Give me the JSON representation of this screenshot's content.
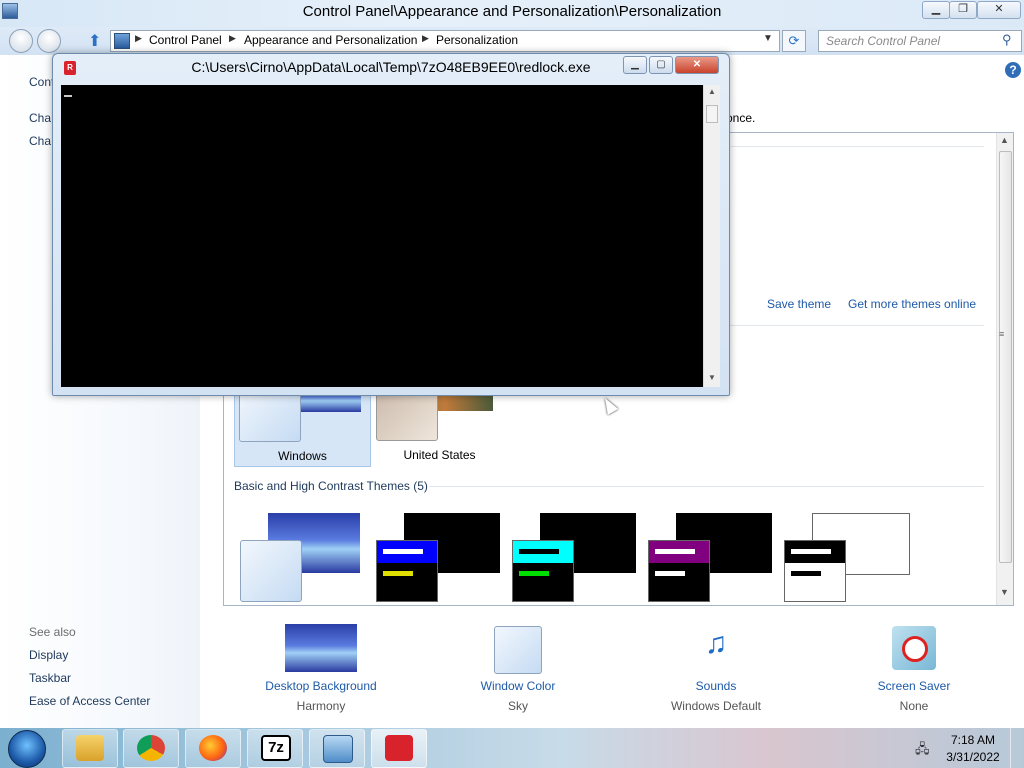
{
  "explorer": {
    "title": "Control Panel\\Appearance and Personalization\\Personalization",
    "breadcrumbs": [
      "Control Panel",
      "Appearance and Personalization",
      "Personalization"
    ],
    "search_placeholder": "Search Control Panel",
    "left_pane": {
      "partial_link": "Cont",
      "links": [
        "Cha",
        "Cha"
      ],
      "see_also_title": "See also",
      "see_also": [
        "Display",
        "Taskbar",
        "Ease of Access Center"
      ]
    },
    "partial_text": "once.",
    "theme_actions": {
      "save": "Save theme",
      "get_more": "Get more themes online"
    },
    "aero_themes": [
      {
        "name": "Windows",
        "selected": true
      },
      {
        "name": "United States",
        "selected": false
      }
    ],
    "basic_section_title": "Basic and High Contrast Themes (5)",
    "bottom_items": [
      {
        "label": "Desktop Background",
        "value": "Harmony"
      },
      {
        "label": "Window Color",
        "value": "Sky"
      },
      {
        "label": "Sounds",
        "value": "Windows Default"
      },
      {
        "label": "Screen Saver",
        "value": "None"
      }
    ]
  },
  "console": {
    "title": "C:\\Users\\Cirno\\AppData\\Local\\Temp\\7zO48EB9EE0\\redlock.exe",
    "icon_letter": "R"
  },
  "taskbar": {
    "pinned": [
      "explorer-icon",
      "chrome-icon",
      "firefox-icon",
      "7zip-icon",
      "control-panel-icon",
      "redlock-icon"
    ],
    "sevenzip_label": "7z",
    "time": "7:18 AM",
    "date": "3/31/2022"
  },
  "colors": {
    "link": "#1e5aa8",
    "console_bg": "#000000",
    "close_red": "#c8432b"
  }
}
